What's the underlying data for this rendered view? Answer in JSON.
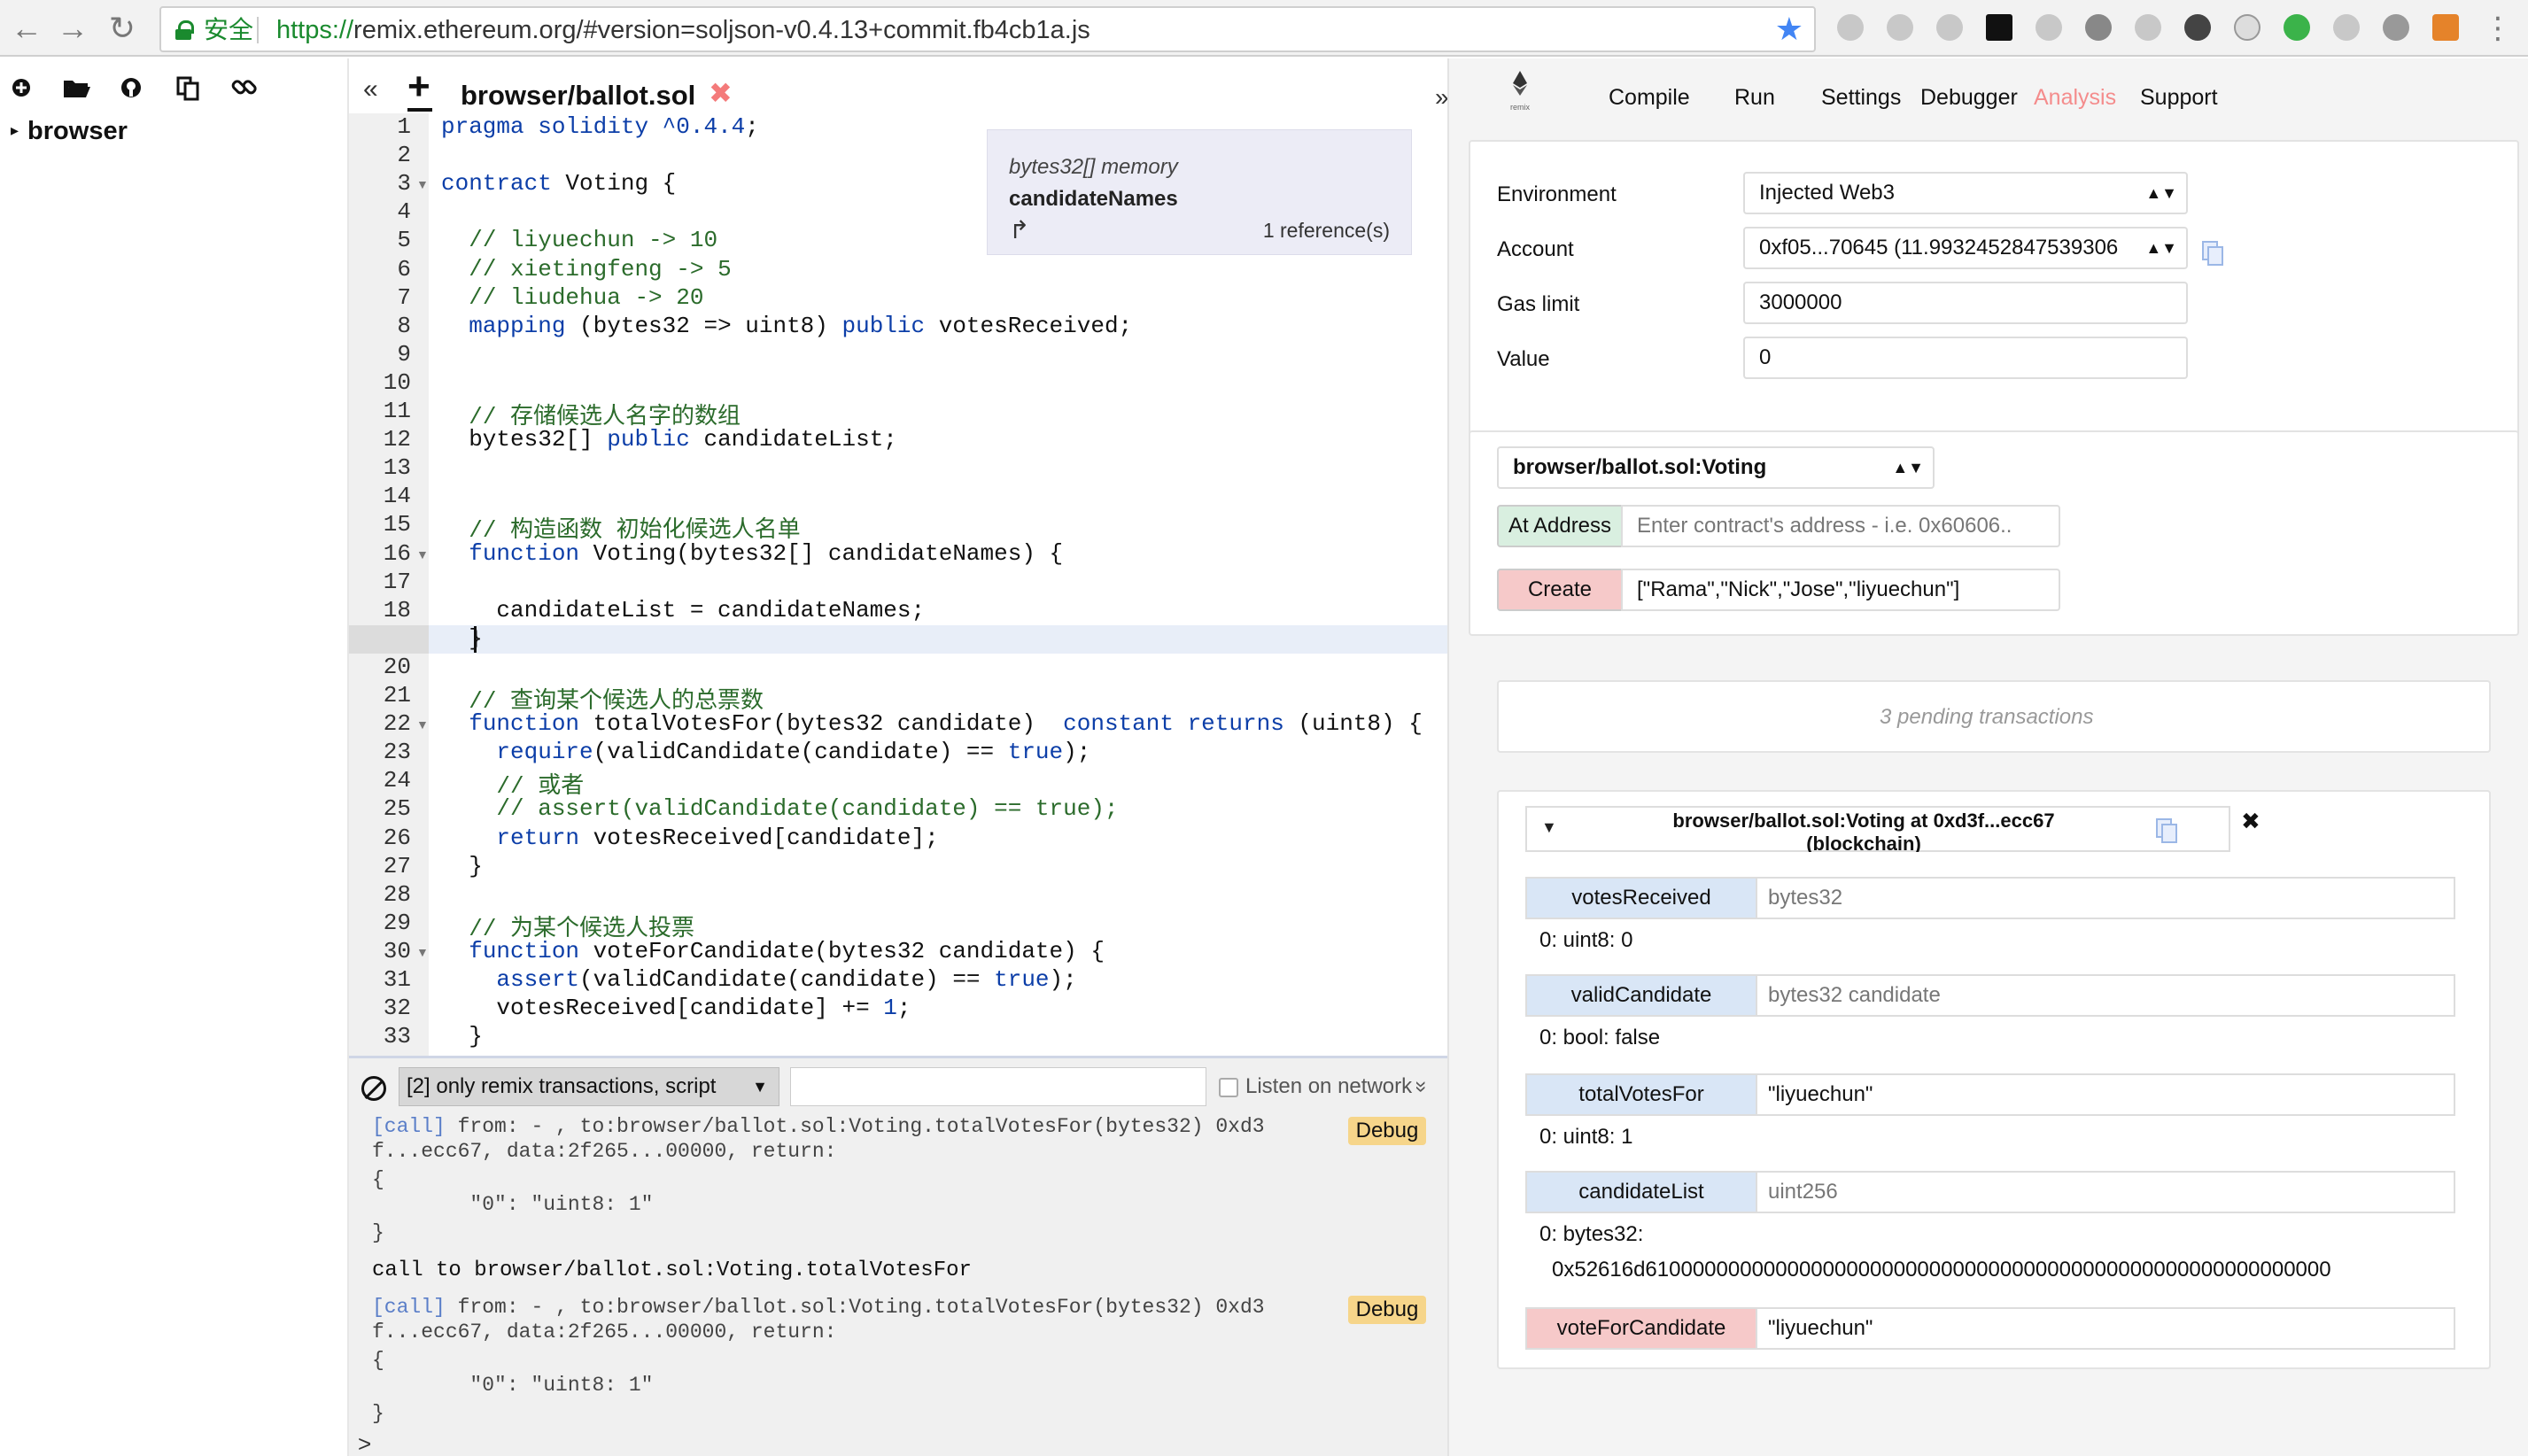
{
  "browser": {
    "secure_label": "安全",
    "url_scheme": "https://",
    "url_rest": "remix.ethereum.org/#version=soljson-v0.4.13+commit.fb4cb1a.js",
    "back": "←",
    "forward": "→",
    "reload": "↻",
    "star": "★"
  },
  "file_explorer": {
    "root": "browser"
  },
  "editor": {
    "collapse_left": "«",
    "collapse_right": "»",
    "new_file": "+",
    "tab_name": "browser/ballot.sol",
    "tab_close": "✖",
    "lines": [
      "pragma solidity ^0.4.4;",
      "",
      "contract Voting {",
      "",
      "  // liyuechun -> 10",
      "  // xietingfeng -> 5",
      "  // liudehua -> 20",
      "  mapping (bytes32 => uint8) public votesReceived;",
      "",
      "",
      "  // 存储候选人名字的数组",
      "  bytes32[] public candidateList;",
      "",
      "",
      "  // 构造函数 初始化候选人名单",
      "  function Voting(bytes32[] candidateNames) {",
      "",
      "    candidateList = candidateNames;",
      "  }",
      "",
      "  // 查询某个候选人的总票数",
      "  function totalVotesFor(bytes32 candidate)  constant returns (uint8) {",
      "    require(validCandidate(candidate) == true);",
      "    // 或者",
      "    // assert(validCandidate(candidate) == true);",
      "    return votesReceived[candidate];",
      "  }",
      "",
      "  // 为某个候选人投票",
      "  function voteForCandidate(bytes32 candidate) {",
      "    assert(validCandidate(candidate) == true);",
      "    votesReceived[candidate] += 1;",
      "  }"
    ],
    "tooltip": {
      "type": "bytes32[] memory",
      "name": "candidateNames",
      "jump": "↱",
      "references": "1 reference(s)"
    }
  },
  "terminal": {
    "filter": "[2] only remix transactions, script",
    "listen_label": "Listen on network",
    "listen_arrow": "»",
    "entries": [
      {
        "line1_tag": "[call]",
        "line1_rest": " from: - , to:browser/ballot.sol:Voting.totalVotesFor(bytes32) 0xd3",
        "line2": "f...ecc67, data:2f265...00000, return:",
        "line3": "{",
        "line4": "        \"0\": \"uint8: 1\"",
        "line5": "}",
        "debug": "Debug"
      },
      {
        "line1_tag": "[call]",
        "line1_rest": " from: - , to:browser/ballot.sol:Voting.totalVotesFor(bytes32) 0xd3",
        "line2": "f...ecc67, data:2f265...00000, return:",
        "line3": "{",
        "line4": "        \"0\": \"uint8: 1\"",
        "line5": "}",
        "debug": "Debug"
      }
    ],
    "plain": "call to browser/ballot.sol:Voting.totalVotesFor",
    "prompt": ">"
  },
  "right_panel": {
    "logo_text": "remix",
    "tabs": [
      "Compile",
      "Run",
      "Settings",
      "Debugger",
      "Analysis",
      "Support"
    ],
    "env": {
      "environment_label": "Environment",
      "environment_value": "Injected Web3",
      "account_label": "Account",
      "account_value": "0xf05...70645 (11.9932452847539306",
      "gas_label": "Gas limit",
      "gas_value": "3000000",
      "value_label": "Value",
      "value_value": "0"
    },
    "contract": {
      "selected": "browser/ballot.sol:Voting",
      "at_address_button": "At Address",
      "at_address_placeholder": "Enter contract's address - i.e. 0x60606..",
      "create_button": "Create",
      "create_args": "[\"Rama\",\"Nick\",\"Jose\",\"liyuechun\"]"
    },
    "pending": "3 pending transactions",
    "instance": {
      "title_line1": "browser/ballot.sol:Voting at 0xd3f...ecc67",
      "title_line2": "(blockchain)",
      "close": "✖",
      "functions": [
        {
          "name": "votesReceived",
          "input": "bytes32",
          "input_is_placeholder": true,
          "output": "0: uint8: 0",
          "kind": "call"
        },
        {
          "name": "validCandidate",
          "input": "bytes32 candidate",
          "input_is_placeholder": true,
          "output": "0: bool: false",
          "kind": "call"
        },
        {
          "name": "totalVotesFor",
          "input": "\"liyuechun\"",
          "input_is_placeholder": false,
          "output": "0: uint8: 1",
          "kind": "call"
        },
        {
          "name": "candidateList",
          "input": "uint256",
          "input_is_placeholder": true,
          "output": "0: bytes32:",
          "output2": "0x52616d6100000000000000000000000000000000000000000000000000000000",
          "kind": "call"
        },
        {
          "name": "voteForCandidate",
          "input": "\"liyuechun\"",
          "input_is_placeholder": false,
          "output": "",
          "kind": "tx"
        }
      ]
    }
  }
}
